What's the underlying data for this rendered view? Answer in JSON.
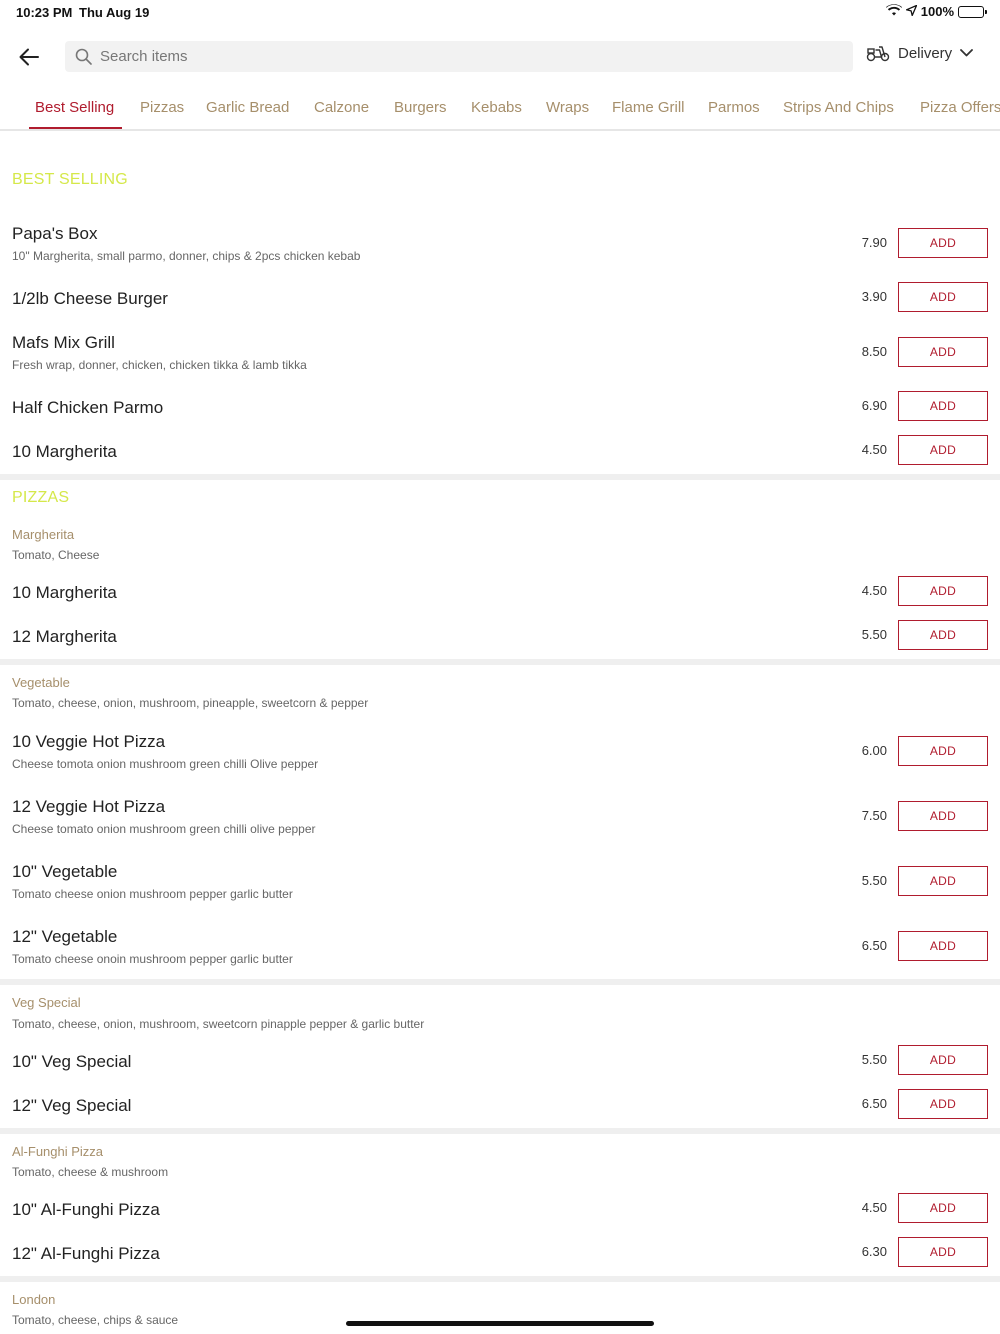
{
  "status_bar": {
    "time": "10:23 PM",
    "date": "Thu Aug 19",
    "battery": "100%"
  },
  "header": {
    "search_placeholder": "Search items",
    "delivery_label": "Delivery"
  },
  "tabs": [
    "Best Selling",
    "Pizzas",
    "Garlic Bread",
    "Calzone",
    "Burgers",
    "Kebabs",
    "Wraps",
    "Flame Grill",
    "Parmos",
    "Strips And Chips",
    "Pizza Offers"
  ],
  "add_label": "ADD",
  "best_selling": {
    "title": "BEST SELLING",
    "items": [
      {
        "name": "Papa's Box",
        "desc": "10\" Margherita, small parmo, donner, chips & 2pcs chicken kebab",
        "price": "7.90"
      },
      {
        "name": "1/2lb Cheese Burger",
        "price": "3.90"
      },
      {
        "name": "Mafs Mix Grill",
        "desc": "Fresh wrap, donner, chicken, chicken tikka & lamb tikka",
        "price": "8.50"
      },
      {
        "name": "Half Chicken Parmo",
        "price": "6.90"
      },
      {
        "name": "10 Margherita",
        "price": "4.50"
      }
    ]
  },
  "pizzas": {
    "title": "PIZZAS",
    "groups": [
      {
        "title": "Margherita",
        "desc": "Tomato, Cheese",
        "items": [
          {
            "name": "10 Margherita",
            "price": "4.50"
          },
          {
            "name": "12 Margherita",
            "price": "5.50"
          }
        ]
      },
      {
        "title": "Vegetable",
        "desc": "Tomato, cheese, onion, mushroom, pineapple, sweetcorn & pepper",
        "items": [
          {
            "name": "10 Veggie Hot Pizza",
            "desc": "Cheese tomota onion mushroom green chilli Olive pepper",
            "price": "6.00"
          },
          {
            "name": "12 Veggie Hot Pizza",
            "desc": "Cheese tomato onion mushroom green chilli olive pepper",
            "price": "7.50"
          },
          {
            "name": "10\" Vegetable",
            "desc": "Tomato cheese onion mushroom pepper garlic butter",
            "price": "5.50"
          },
          {
            "name": "12\" Vegetable",
            "desc": "Tomato cheese onoin mushroom pepper garlic butter",
            "price": "6.50"
          }
        ]
      },
      {
        "title": "Veg Special",
        "desc": "Tomato, cheese, onion, mushroom, sweetcorn pinapple pepper & garlic butter",
        "items": [
          {
            "name": "10\" Veg Special",
            "price": "5.50"
          },
          {
            "name": "12\" Veg Special",
            "price": "6.50"
          }
        ]
      },
      {
        "title": "Al-Funghi Pizza",
        "desc": "Tomato, cheese & mushroom",
        "items": [
          {
            "name": "10\" Al-Funghi Pizza",
            "price": "4.50"
          },
          {
            "name": "12\" Al-Funghi Pizza",
            "price": "6.30"
          }
        ]
      },
      {
        "title": "London",
        "desc": "Tomato, cheese, chips & sauce",
        "items": []
      }
    ]
  }
}
